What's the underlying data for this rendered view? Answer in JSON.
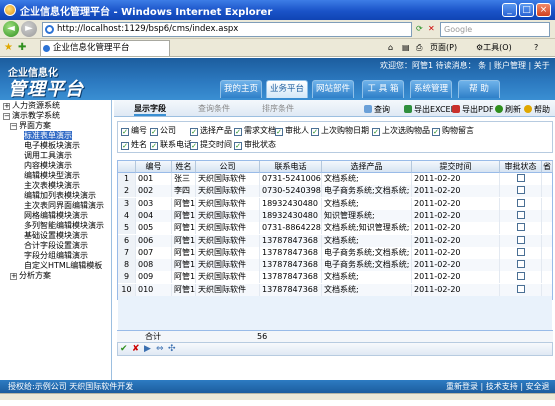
{
  "window": {
    "title": "企业信息化管理平台 - Windows Internet Explorer",
    "min": "_",
    "max": "□",
    "close": "×"
  },
  "browser": {
    "back": "◄",
    "forward": "►",
    "address": "http://localhost:1129/bsp6/cms/index.aspx",
    "search_placeholder": "Google",
    "tab_title": "企业信息化管理平台",
    "page_menu": "页面(P)",
    "tools_menu": "工具(O)",
    "help": "?"
  },
  "header": {
    "logo_top": "企业信息化",
    "logo_main": "管理平台",
    "welcome": "欢迎您：阿管1 待读消息： 条 | 账户管理 | 关于",
    "tabs": [
      {
        "label": "我的主页",
        "active": false
      },
      {
        "label": "业务平台",
        "active": true
      },
      {
        "label": "网站部件",
        "active": false
      },
      {
        "label": "工 具 箱",
        "active": false
      },
      {
        "label": "系统管理",
        "active": false
      },
      {
        "label": "帮 助",
        "active": false
      }
    ]
  },
  "sidebar": {
    "items": [
      {
        "label": "人力资源系统",
        "level": 0,
        "box": "+"
      },
      {
        "label": "演示教学系统",
        "level": 0,
        "box": "−"
      },
      {
        "label": "界面方案",
        "level": 1,
        "box": "−"
      },
      {
        "label": "标准表单演示",
        "level": 2,
        "selected": true
      },
      {
        "label": "电子模板块演示",
        "level": 2
      },
      {
        "label": "调用工具演示",
        "level": 2
      },
      {
        "label": "内容模块演示",
        "level": 2
      },
      {
        "label": "编辑模块型演示",
        "level": 2
      },
      {
        "label": "主次表模块演示",
        "level": 2
      },
      {
        "label": "编辑加列表模块演示",
        "level": 2
      },
      {
        "label": "主次表同界面编辑演示",
        "level": 2
      },
      {
        "label": "网格编辑模块演示",
        "level": 2
      },
      {
        "label": "多列智能编辑模块演示",
        "level": 2
      },
      {
        "label": "基础设置模块演示",
        "level": 2
      },
      {
        "label": "合计字段设置演示",
        "level": 2
      },
      {
        "label": "字段分组编辑演示",
        "level": 2
      },
      {
        "label": "自定义HTML编辑模板",
        "level": 2
      },
      {
        "label": "分析方案",
        "level": 1,
        "box": "+"
      }
    ]
  },
  "subtabs": [
    "显示字段",
    "查询条件",
    "排序条件"
  ],
  "toolbar": {
    "query": "查询",
    "export_excel": "导出EXCEL",
    "export_pdf": "导出PDF",
    "refresh": "刷新",
    "help": "帮助"
  },
  "fields": [
    [
      "编号",
      "公司",
      "选择产品",
      "需求文档",
      "审批人",
      "上次购物日期",
      "上次选购物品",
      "购物留言"
    ],
    [
      "姓名",
      "联系电话",
      "提交时间",
      "审批状态"
    ]
  ],
  "grid": {
    "columns": [
      "",
      "编号",
      "姓名",
      "公司",
      "联系电话",
      "选择产品",
      "提交时间",
      "审批状态",
      "省"
    ],
    "rows": [
      [
        "1",
        "001",
        "张三",
        "天织国际软件",
        "0731-5241006",
        "文档系统;",
        "2011-02-20"
      ],
      [
        "2",
        "002",
        "李四",
        "天织国际软件",
        "0730-5240398",
        "电子商务系统;文档系统;",
        "2011-02-20"
      ],
      [
        "3",
        "003",
        "阿管1",
        "天织国际软件",
        "18932430480",
        "文档系统;",
        "2011-02-20"
      ],
      [
        "4",
        "004",
        "阿管1",
        "天织国际软件",
        "18932430480",
        "知识管理系统;",
        "2011-02-20"
      ],
      [
        "5",
        "005",
        "阿管1",
        "天织国际软件",
        "0731-8864228",
        "文档系统;知识管理系统;",
        "2011-02-20"
      ],
      [
        "6",
        "006",
        "阿管1",
        "天织国际软件",
        "13787847368",
        "文档系统;",
        "2011-02-20"
      ],
      [
        "7",
        "007",
        "阿管1",
        "天织国际软件",
        "13787847368",
        "电子商务系统;文档系统;",
        "2011-02-20"
      ],
      [
        "8",
        "008",
        "阿管1",
        "天织国际软件",
        "13787847368",
        "电子商务系统;文档系统;",
        "2011-02-20"
      ],
      [
        "9",
        "009",
        "阿管1",
        "天织国际软件",
        "13787847368",
        "文档系统;",
        "2011-02-20"
      ],
      [
        "10",
        "010",
        "阿管1",
        "天织国际软件",
        "13787847368",
        "文档系统;",
        "2011-02-20"
      ]
    ],
    "sum_label": "合计",
    "sum_value": "56"
  },
  "footer": {
    "left": "授权给:示例公司  天织国际软件开发",
    "right": "重新登录 | 技术支持 | 安全退出"
  },
  "colors": {
    "header": "#1c5d9e",
    "accent": "#3a8fd2",
    "titlebar": "#1a53c8"
  }
}
